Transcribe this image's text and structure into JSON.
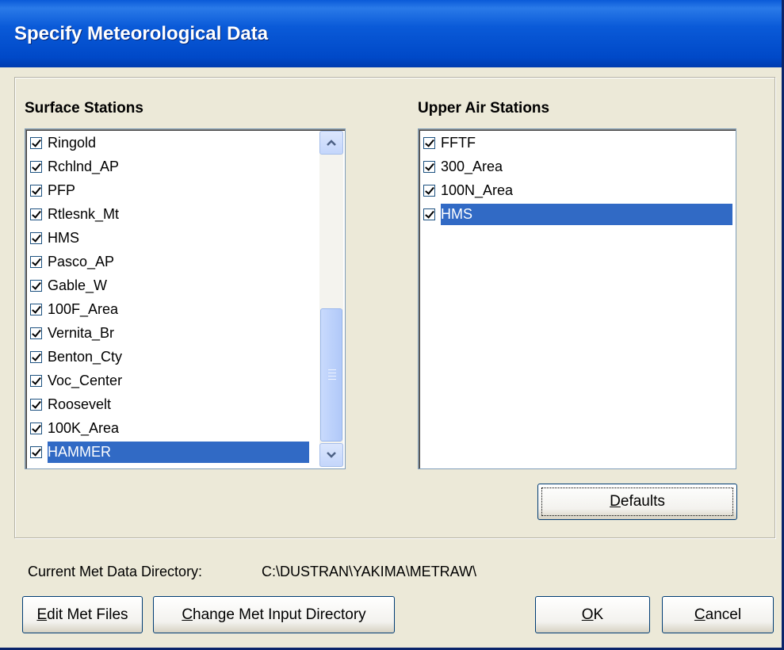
{
  "window": {
    "title": "Specify Meteorological Data"
  },
  "surface": {
    "heading": "Surface Stations",
    "items": [
      "Ringold",
      "Rchlnd_AP",
      "PFP",
      "Rtlesnk_Mt",
      "HMS",
      "Pasco_AP",
      "Gable_W",
      "100F_Area",
      "Vernita_Br",
      "Benton_Cty",
      "Voc_Center",
      "Roosevelt",
      "100K_Area",
      "HAMMER"
    ],
    "selected": "HAMMER"
  },
  "upper_air": {
    "heading": "Upper Air Stations",
    "items": [
      "FFTF",
      "300_Area",
      "100N_Area",
      "HMS"
    ],
    "selected": "HMS"
  },
  "buttons": {
    "defaults": {
      "accel": "D",
      "rest": "efaults"
    },
    "edit_met": {
      "accel": "E",
      "rest": "dit Met Files"
    },
    "change_dir": {
      "accel": "C",
      "rest": "hange Met Input Directory"
    },
    "ok": {
      "accel": "O",
      "rest": "K"
    },
    "cancel": {
      "accel": "C",
      "rest": "ancel"
    }
  },
  "directory": {
    "label": "Current Met Data Directory:",
    "value": "C:\\DUSTRAN\\YAKIMA\\METRAW\\"
  },
  "icons": {
    "check": "checkmark-icon",
    "up": "chevron-up-icon",
    "down": "chevron-down-icon"
  },
  "colors": {
    "titlebar": "#0a5ad8",
    "selection": "#316ac5",
    "face": "#ece9d8"
  }
}
